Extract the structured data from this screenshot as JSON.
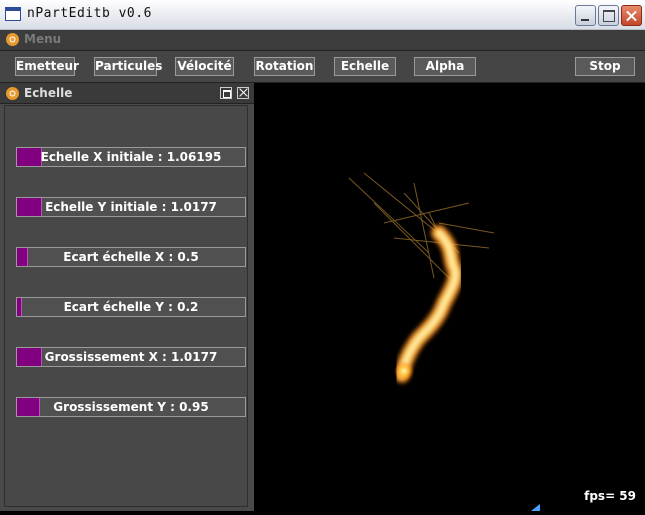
{
  "window": {
    "title": "nPartEditb v0.6"
  },
  "menu": {
    "label": "Menu"
  },
  "toolbar": {
    "buttons": [
      {
        "label": "Emetteur"
      },
      {
        "label": "Particules"
      },
      {
        "label": "Vélocité"
      },
      {
        "label": "Rotation"
      },
      {
        "label": "Echelle"
      },
      {
        "label": "Alpha"
      },
      {
        "label": "Stop"
      }
    ]
  },
  "panel": {
    "title": "Echelle",
    "sliders": [
      {
        "label": "Echelle X initiale : 1.06195",
        "fill_fraction": 0.11
      },
      {
        "label": "Echelle Y initiale : 1.0177",
        "fill_fraction": 0.11
      },
      {
        "label": "Ecart échelle X : 0.5",
        "fill_fraction": 0.05
      },
      {
        "label": "Ecart échelle Y : 0.2",
        "fill_fraction": 0.02
      },
      {
        "label": "Grossissement X : 1.0177",
        "fill_fraction": 0.11
      },
      {
        "label": "Grossissement Y : 0.95",
        "fill_fraction": 0.1
      }
    ]
  },
  "viewport": {
    "fps": "fps= 59"
  },
  "colors": {
    "slider_fill": "#800080",
    "background": "#000000",
    "panel": "#4a4a4a",
    "flame_core": "#ffd24a",
    "flame_edge": "#ff7a10"
  }
}
